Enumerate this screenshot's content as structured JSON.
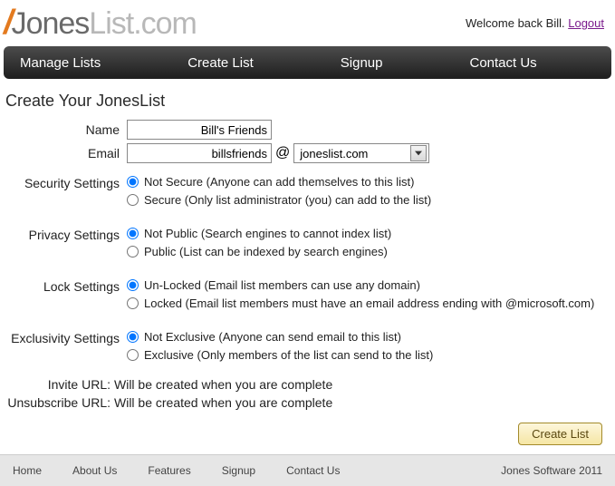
{
  "header": {
    "logo_jones": "Jones",
    "logo_list": "List.com",
    "welcome_prefix": "Welcome back ",
    "welcome_name": "Bill",
    "welcome_suffix": ". ",
    "logout": "Logout"
  },
  "nav": {
    "manage": "Manage Lists",
    "create": "Create List",
    "signup": "Signup",
    "contact": "Contact Us"
  },
  "page": {
    "title": "Create Your JonesList"
  },
  "form": {
    "name_label": "Name",
    "name_value": "Bill's Friends",
    "email_label": "Email",
    "email_local": "billsfriends",
    "email_at": "@",
    "email_domain": "joneslist.com",
    "security": {
      "label": "Security Settings",
      "notsecure": "Not Secure (Anyone can add themselves to this list)",
      "secure": "Secure (Only list administrator (you) can add to the list)"
    },
    "privacy": {
      "label": "Privacy Settings",
      "notpublic": "Not Public (Search engines to cannot index list)",
      "public": "Public (List can be indexed by search engines)"
    },
    "lock": {
      "label": "Lock Settings",
      "unlocked": "Un-Locked (Email list members can use any domain)",
      "locked": "Locked (Email list members must have an email address ending with @microsoft.com)"
    },
    "exclusivity": {
      "label": "Exclusivity Settings",
      "notexclusive": "Not Exclusive (Anyone can send email to this list)",
      "exclusive": "Exclusive (Only members of the list can send to the list)"
    },
    "invite_label": "Invite URL:",
    "invite_value": "Will be created when you are complete",
    "unsub_label": "Unsubscribe URL:",
    "unsub_value": "Will be created when you are complete",
    "create_btn": "Create List"
  },
  "footer": {
    "home": "Home",
    "about": "About Us",
    "features": "Features",
    "signup": "Signup",
    "contact": "Contact Us",
    "copyright": "Jones Software 2011"
  }
}
